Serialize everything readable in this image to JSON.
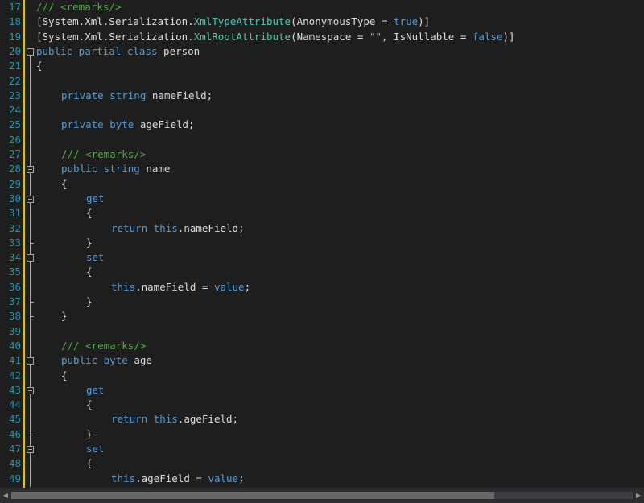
{
  "colors": {
    "background": "#1e1e1e",
    "line_number": "#2b91af",
    "keyword": "#569cd6",
    "type": "#4ec9b0",
    "comment": "#57a64a",
    "string": "#d69d85",
    "plain": "#dcdcdc",
    "change_marker": "#d7ba30"
  },
  "editor": {
    "lines": [
      {
        "number": "17",
        "indent": 0,
        "tokens": [
          {
            "t": "com",
            "v": "/// <remarks/>"
          }
        ]
      },
      {
        "number": "18",
        "indent": 0,
        "tokens": [
          {
            "t": "plain",
            "v": "[System.Xml.Serialization."
          },
          {
            "t": "type",
            "v": "XmlTypeAttribute"
          },
          {
            "t": "plain",
            "v": "(AnonymousType = "
          },
          {
            "t": "kw",
            "v": "true"
          },
          {
            "t": "plain",
            "v": ")]"
          }
        ]
      },
      {
        "number": "19",
        "indent": 0,
        "tokens": [
          {
            "t": "plain",
            "v": "[System.Xml.Serialization."
          },
          {
            "t": "type",
            "v": "XmlRootAttribute"
          },
          {
            "t": "plain",
            "v": "(Namespace = "
          },
          {
            "t": "str",
            "v": "\"\""
          },
          {
            "t": "plain",
            "v": ", IsNullable = "
          },
          {
            "t": "kw",
            "v": "false"
          },
          {
            "t": "plain",
            "v": ")]"
          }
        ]
      },
      {
        "number": "20",
        "indent": 0,
        "tokens": [
          {
            "t": "kw",
            "v": "public partial class "
          },
          {
            "t": "plain",
            "v": "person"
          }
        ]
      },
      {
        "number": "21",
        "indent": 0,
        "tokens": [
          {
            "t": "plain",
            "v": "{"
          }
        ]
      },
      {
        "number": "22",
        "indent": 0,
        "tokens": []
      },
      {
        "number": "23",
        "indent": 1,
        "tokens": [
          {
            "t": "kw",
            "v": "private string "
          },
          {
            "t": "plain",
            "v": "nameField;"
          }
        ]
      },
      {
        "number": "24",
        "indent": 0,
        "tokens": []
      },
      {
        "number": "25",
        "indent": 1,
        "tokens": [
          {
            "t": "kw",
            "v": "private byte "
          },
          {
            "t": "plain",
            "v": "ageField;"
          }
        ]
      },
      {
        "number": "26",
        "indent": 0,
        "tokens": []
      },
      {
        "number": "27",
        "indent": 1,
        "tokens": [
          {
            "t": "com",
            "v": "/// <remarks/>"
          }
        ]
      },
      {
        "number": "28",
        "indent": 1,
        "tokens": [
          {
            "t": "kw",
            "v": "public string "
          },
          {
            "t": "plain",
            "v": "name"
          }
        ]
      },
      {
        "number": "29",
        "indent": 1,
        "tokens": [
          {
            "t": "plain",
            "v": "{"
          }
        ]
      },
      {
        "number": "30",
        "indent": 2,
        "tokens": [
          {
            "t": "kw",
            "v": "get"
          }
        ]
      },
      {
        "number": "31",
        "indent": 2,
        "tokens": [
          {
            "t": "plain",
            "v": "{"
          }
        ]
      },
      {
        "number": "32",
        "indent": 3,
        "tokens": [
          {
            "t": "kw",
            "v": "return this"
          },
          {
            "t": "plain",
            "v": ".nameField;"
          }
        ]
      },
      {
        "number": "33",
        "indent": 2,
        "tokens": [
          {
            "t": "plain",
            "v": "}"
          }
        ]
      },
      {
        "number": "34",
        "indent": 2,
        "tokens": [
          {
            "t": "kw",
            "v": "set"
          }
        ]
      },
      {
        "number": "35",
        "indent": 2,
        "tokens": [
          {
            "t": "plain",
            "v": "{"
          }
        ]
      },
      {
        "number": "36",
        "indent": 3,
        "tokens": [
          {
            "t": "kw",
            "v": "this"
          },
          {
            "t": "plain",
            "v": ".nameField = "
          },
          {
            "t": "kw",
            "v": "value"
          },
          {
            "t": "plain",
            "v": ";"
          }
        ]
      },
      {
        "number": "37",
        "indent": 2,
        "tokens": [
          {
            "t": "plain",
            "v": "}"
          }
        ]
      },
      {
        "number": "38",
        "indent": 1,
        "tokens": [
          {
            "t": "plain",
            "v": "}"
          }
        ]
      },
      {
        "number": "39",
        "indent": 0,
        "tokens": []
      },
      {
        "number": "40",
        "indent": 1,
        "tokens": [
          {
            "t": "com",
            "v": "/// <remarks/>"
          }
        ]
      },
      {
        "number": "41",
        "indent": 1,
        "tokens": [
          {
            "t": "kw",
            "v": "public byte "
          },
          {
            "t": "plain",
            "v": "age"
          }
        ]
      },
      {
        "number": "42",
        "indent": 1,
        "tokens": [
          {
            "t": "plain",
            "v": "{"
          }
        ]
      },
      {
        "number": "43",
        "indent": 2,
        "tokens": [
          {
            "t": "kw",
            "v": "get"
          }
        ]
      },
      {
        "number": "44",
        "indent": 2,
        "tokens": [
          {
            "t": "plain",
            "v": "{"
          }
        ]
      },
      {
        "number": "45",
        "indent": 3,
        "tokens": [
          {
            "t": "kw",
            "v": "return this"
          },
          {
            "t": "plain",
            "v": ".ageField;"
          }
        ]
      },
      {
        "number": "46",
        "indent": 2,
        "tokens": [
          {
            "t": "plain",
            "v": "}"
          }
        ]
      },
      {
        "number": "47",
        "indent": 2,
        "tokens": [
          {
            "t": "kw",
            "v": "set"
          }
        ]
      },
      {
        "number": "48",
        "indent": 2,
        "tokens": [
          {
            "t": "plain",
            "v": "{"
          }
        ]
      },
      {
        "number": "49",
        "indent": 3,
        "tokens": [
          {
            "t": "kw",
            "v": "this"
          },
          {
            "t": "plain",
            "v": ".ageField = "
          },
          {
            "t": "kw",
            "v": "value"
          },
          {
            "t": "plain",
            "v": ";"
          }
        ]
      }
    ],
    "folding": {
      "collapsible_lines": [
        "20",
        "28",
        "30",
        "34",
        "41",
        "43",
        "47"
      ],
      "end_lines": [
        "33",
        "37",
        "38",
        "46"
      ]
    }
  }
}
